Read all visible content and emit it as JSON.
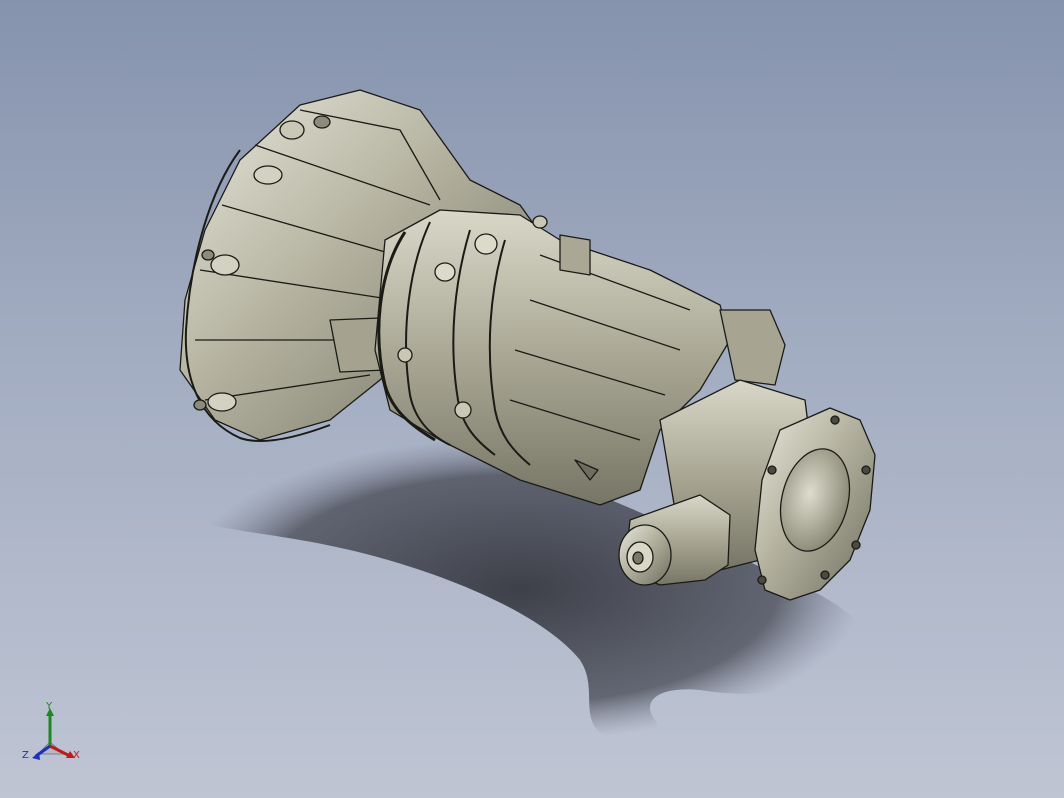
{
  "viewport": {
    "background_top": "#8693ad",
    "background_bottom": "#bfc5d3"
  },
  "model": {
    "subject": "manual-transmission-gearbox-assembly",
    "body_color": "#b7b5a2",
    "edge_color": "#1b1b16",
    "shadow_color": "#2f3037"
  },
  "triad": {
    "y_label": "Y",
    "x_label": "X",
    "z_label": "Z",
    "y_color": "#1a8a1a",
    "x_color": "#c41818",
    "z_color": "#1c2fbf"
  }
}
